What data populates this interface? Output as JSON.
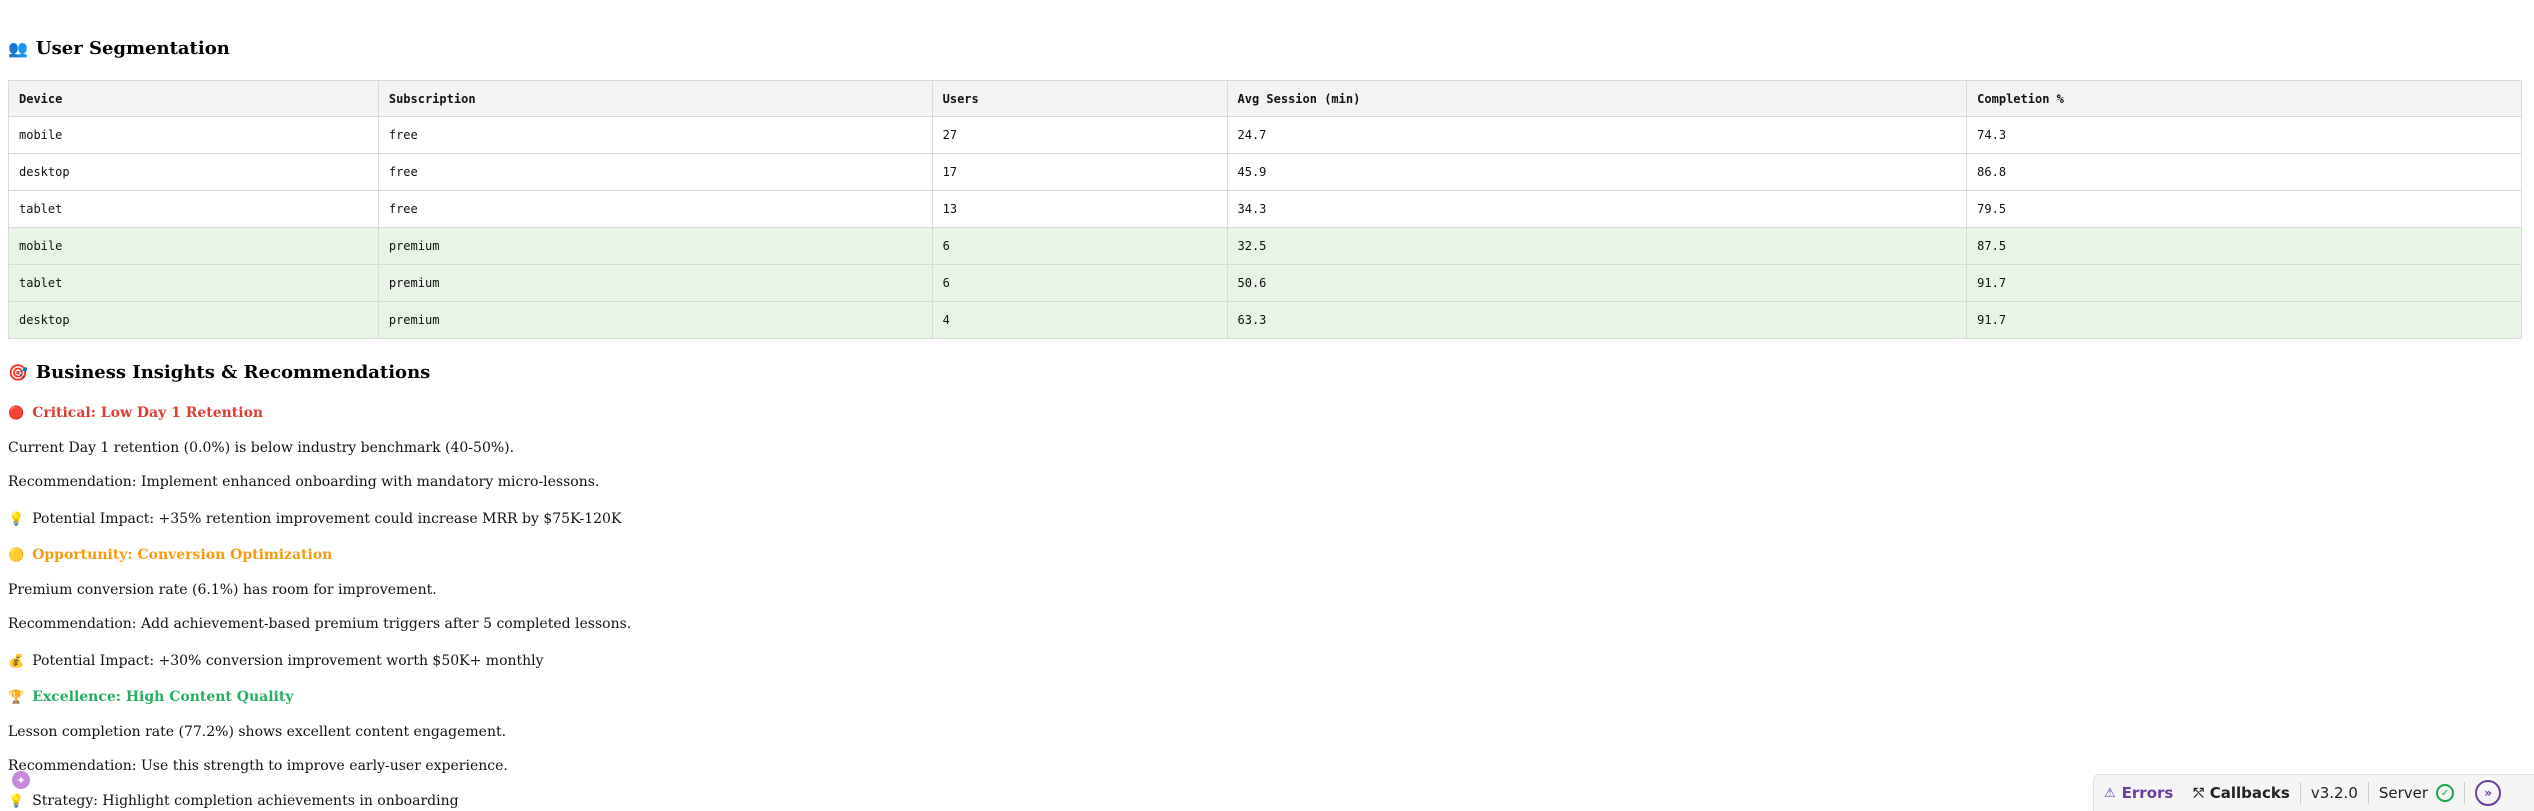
{
  "segmentation": {
    "icon": "users-icon",
    "title": "User Segmentation",
    "columns": [
      "Device",
      "Subscription",
      "Users",
      "Avg Session (min)",
      "Completion %"
    ],
    "rows": [
      {
        "device": "mobile",
        "subscription": "free",
        "users": "27",
        "avg_session": "24.7",
        "completion": "74.3"
      },
      {
        "device": "desktop",
        "subscription": "free",
        "users": "17",
        "avg_session": "45.9",
        "completion": "86.8"
      },
      {
        "device": "tablet",
        "subscription": "free",
        "users": "13",
        "avg_session": "34.3",
        "completion": "79.5"
      },
      {
        "device": "mobile",
        "subscription": "premium",
        "users": "6",
        "avg_session": "32.5",
        "completion": "87.5"
      },
      {
        "device": "tablet",
        "subscription": "premium",
        "users": "6",
        "avg_session": "50.6",
        "completion": "91.7"
      },
      {
        "device": "desktop",
        "subscription": "premium",
        "users": "4",
        "avg_session": "63.3",
        "completion": "91.7"
      }
    ],
    "premium_row_color": "#e8f4e6"
  },
  "insights": {
    "icon": "target-icon",
    "title": "Business Insights & Recommendations",
    "critical": {
      "icon": "red-circle-icon",
      "heading": "Critical: Low Day 1 Retention",
      "color": "#e03c31",
      "line1": "Current Day 1 retention (0.0%) is below industry benchmark (40-50%).",
      "line2": "Recommendation: Implement enhanced onboarding with mandatory micro-lessons.",
      "impact_icon": "lightbulb-icon",
      "impact": "Potential Impact: +35% retention improvement could increase MRR by $75K-120K"
    },
    "opportunity": {
      "icon": "yellow-circle-icon",
      "heading": "Opportunity: Conversion Optimization",
      "color": "#f39c12",
      "line1": "Premium conversion rate (6.1%) has room for improvement.",
      "line2": "Recommendation: Add achievement-based premium triggers after 5 completed lessons.",
      "impact_icon": "money-bag-icon",
      "impact": "Potential Impact: +30% conversion improvement worth $50K+ monthly"
    },
    "excellence": {
      "icon": "trophy-icon",
      "heading": "Excellence: High Content Quality",
      "color": "#27ae60",
      "line1": "Lesson completion rate (77.2%) shows excellent content engagement.",
      "line2": "Recommendation: Use this strength to improve early-user experience.",
      "impact_icon": "lightbulb-icon",
      "impact": "Strategy: Highlight completion achievements in onboarding"
    }
  },
  "debug_bar": {
    "errors_label": "Errors",
    "callbacks_label": "Callbacks",
    "version": "v3.2.0",
    "server_label": "Server",
    "errors_icon": "warning-icon",
    "callbacks_icon": "callbacks-icon",
    "server_icon": "check-circle-icon",
    "expand_icon": "chevron-right-icon"
  }
}
